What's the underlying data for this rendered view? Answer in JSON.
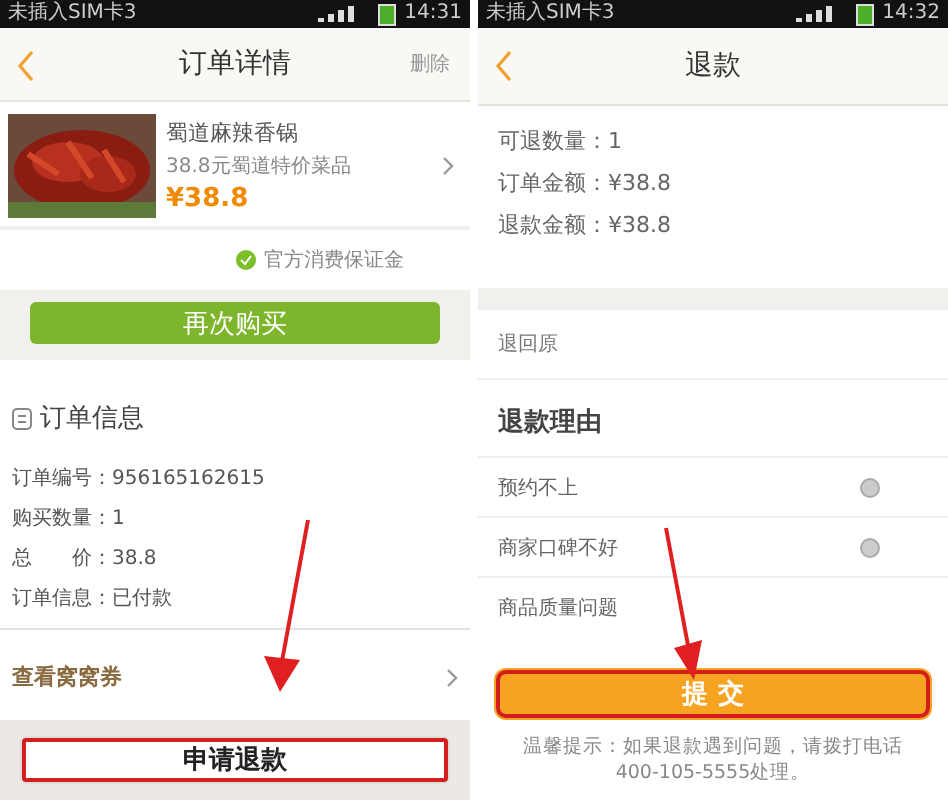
{
  "left": {
    "status_bar": {
      "carrier": "未插入SIM卡3",
      "time": "14:31"
    },
    "header": {
      "title": "订单详情",
      "action": "删除"
    },
    "product": {
      "kind": "picture",
      "name": "蜀道麻辣香锅",
      "desc": "38.8元蜀道特价菜品",
      "price": "¥38.8"
    },
    "guarantee": "官方消费保证金",
    "buy_again": "再次购买",
    "section_title": "订单信息",
    "info_rows": [
      "订单编号：956165162615",
      "购买数量：1",
      "总　　价：38.8",
      "订单信息：已付款"
    ],
    "coupon_link": "查看窝窝券",
    "refund_button": {
      "label": "申请退款",
      "highlighted": true
    }
  },
  "right": {
    "status_bar": {
      "carrier": "未插入SIM卡3",
      "time": "14:32"
    },
    "header": {
      "title": "退款"
    },
    "info_rows": [
      "可退数量：1",
      "订单金额：¥38.8",
      "退款金额：¥38.8"
    ],
    "refund_to": "退回原",
    "reason_title": "退款理由",
    "reasons": [
      {
        "label": "预约不上",
        "selected": false
      },
      {
        "label": "商家口碑不好",
        "selected": false
      },
      {
        "label": "商品质量问题"
      }
    ],
    "submit_button": {
      "label": "提 交",
      "highlighted": true
    },
    "tip": "温馨提示：如果退款遇到问题，请拨打电话400-105-5555处理。"
  }
}
